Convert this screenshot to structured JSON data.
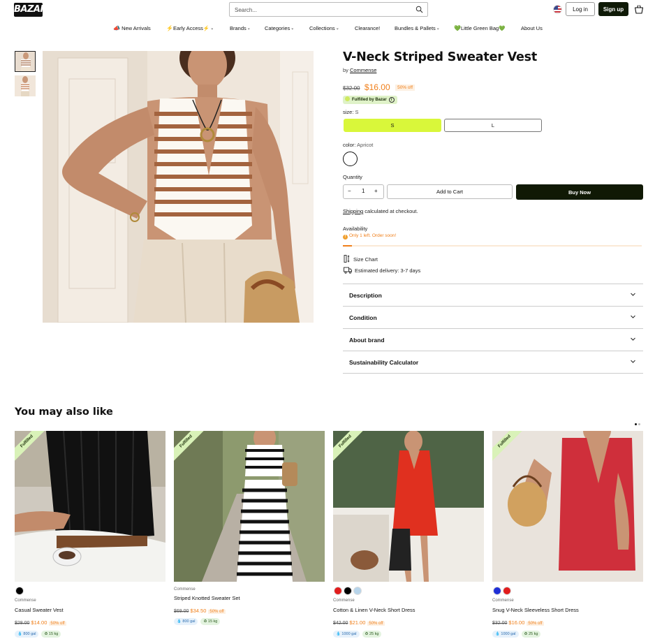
{
  "header": {
    "logo": "BAZAR",
    "search_placeholder": "Search...",
    "login_label": "Log in",
    "signup_label": "Sign up"
  },
  "nav": [
    {
      "emoji": "📣",
      "label": "New Arrivals",
      "dropdown": false
    },
    {
      "emoji": "⚡",
      "label": "Early Access⚡",
      "dropdown": true
    },
    {
      "emoji": "",
      "label": "Brands",
      "dropdown": true
    },
    {
      "emoji": "",
      "label": "Categories",
      "dropdown": true
    },
    {
      "emoji": "",
      "label": "Collections",
      "dropdown": true
    },
    {
      "emoji": "",
      "label": "Clearance!",
      "dropdown": false
    },
    {
      "emoji": "",
      "label": "Bundles & Pallets",
      "dropdown": true
    },
    {
      "emoji": "💚",
      "label": "Little Green Bag💚",
      "dropdown": false
    },
    {
      "emoji": "",
      "label": "About Us",
      "dropdown": false
    }
  ],
  "product": {
    "title": "V-Neck Striped Sweater Vest",
    "by_label": "by",
    "brand": "Commense",
    "old_price": "$32.00",
    "price": "$16.00",
    "discount": "50% off",
    "fulfilled_label": "Fulfilled by Bazar",
    "size_label": "size:",
    "size_value": "S",
    "sizes": [
      "S",
      "L"
    ],
    "color_label": "color:",
    "color_value": "Apricot",
    "quantity_label": "Quantity",
    "quantity": "1",
    "add_to_cart": "Add to Cart",
    "buy_now": "Buy Now",
    "shipping_link": "Shipping",
    "shipping_rest": " calculated at checkout.",
    "availability_label": "Availability",
    "stock_text": "Only 1 left. Order soon!",
    "stock_fraction": 0.03,
    "size_chart": "Size Chart",
    "delivery": "Estimated delivery: 3-7 days",
    "accordions": [
      "Description",
      "Condition",
      "About brand",
      "Sustainability Calculator"
    ]
  },
  "recommendations": {
    "title": "You may also like",
    "cards": [
      {
        "ribbon": "Fulfilled",
        "swatches": [
          "#000000"
        ],
        "brand": "Commense",
        "name": "Casual Sweater Vest",
        "old_price": "$28.00",
        "price": "$14.00",
        "discount": "50% off",
        "water": "800 gal",
        "co2": "15 kg"
      },
      {
        "ribbon": "Fulfilled",
        "swatches": [],
        "brand": "Commense",
        "name": "Striped Knotted Sweater Set",
        "old_price": "$69.00",
        "price": "$34.50",
        "discount": "50% off",
        "water": "800 gal",
        "co2": "15 kg"
      },
      {
        "ribbon": "Fulfilled",
        "swatches": [
          "#e11d1d",
          "#000000",
          "#b7d4ea"
        ],
        "brand": "Commense",
        "name": "Cotton & Linen V-Neck Short Dress",
        "old_price": "$42.00",
        "price": "$21.00",
        "discount": "50% off",
        "water": "1000 gal",
        "co2": "25 kg"
      },
      {
        "ribbon": "Fulfilled",
        "swatches": [
          "#1f2fd6",
          "#e11d1d"
        ],
        "brand": "Commense",
        "name": "Snug V-Neck Sleeveless Short Dress",
        "old_price": "$32.00",
        "price": "$16.00",
        "discount": "50% off",
        "water": "1000 gal",
        "co2": "25 kg"
      }
    ]
  },
  "colors": {
    "accent_lime": "#d9f73a",
    "price_orange": "#f07f1a",
    "dark": "#101905"
  }
}
